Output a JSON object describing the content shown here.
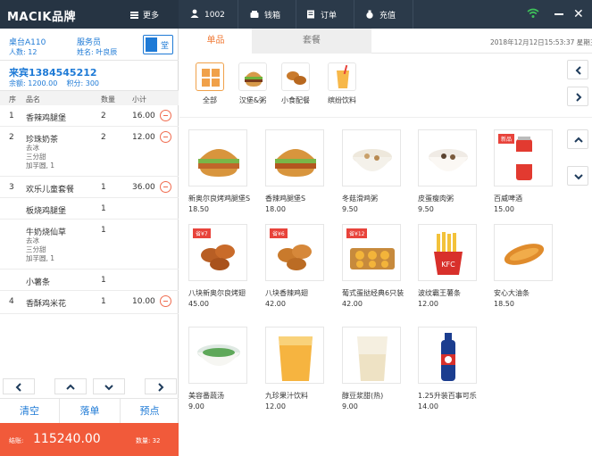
{
  "topbar": {
    "brand": "MACIK品牌",
    "more": "更多",
    "user": "1002",
    "cashbox": "钱箱",
    "orders": "订单",
    "recharge": "充值"
  },
  "left": {
    "table": "桌台A110",
    "people": "人数: 12",
    "waiter_label": "服务员",
    "waiter_name": "姓名: 叶良辰",
    "toggle_label": "堂",
    "member_name": "来宾1384545212",
    "member_balance": "余额: 1200.00",
    "member_points": "积分: 300",
    "headers": {
      "no": "序",
      "name": "品名",
      "qty": "数量",
      "sub": "小计"
    },
    "orders": [
      {
        "no": "1",
        "name": "香辣鸡腿堡",
        "qty": "2",
        "price": "16.00",
        "extras": []
      },
      {
        "no": "2",
        "name": "珍珠奶茶",
        "qty": "2",
        "price": "12.00",
        "extras": [
          "去冰",
          "三分甜",
          "加芋圆, 1"
        ]
      },
      {
        "no": "3",
        "name": "欢乐儿童套餐",
        "qty": "1",
        "price": "36.00",
        "extras": []
      },
      {
        "no": "",
        "name": "板烧鸡腿堡",
        "qty": "1",
        "price": "",
        "extras": []
      },
      {
        "no": "",
        "name": "牛奶烧仙草",
        "qty": "1",
        "price": "",
        "extras": [
          "去冰",
          "三分甜",
          "加芋圆, 1"
        ]
      },
      {
        "no": "",
        "name": "小薯条",
        "qty": "1",
        "price": "",
        "extras": []
      },
      {
        "no": "4",
        "name": "香酥鸡米花",
        "qty": "1",
        "price": "10.00",
        "extras": []
      }
    ],
    "btn_clear": "清空",
    "btn_place": "落单",
    "btn_preorder": "预点",
    "total_label": "结账:",
    "total_value": "115240.00",
    "count_label": "数量: 32"
  },
  "tabs": {
    "single": "单品",
    "combo": "套餐"
  },
  "datetime": "2018年12月12日15:53:37  星期三",
  "categories": [
    {
      "label": "全部"
    },
    {
      "label": "汉堡&粥"
    },
    {
      "label": "小食配餐"
    },
    {
      "label": "缤纷饮料"
    }
  ],
  "products": [
    {
      "name": "新奥尔良烤鸡腿堡S",
      "price": "18.50",
      "tag": ""
    },
    {
      "name": "香辣鸡腿堡S",
      "price": "18.00",
      "tag": ""
    },
    {
      "name": "冬菇滑鸡粥",
      "price": "9.50",
      "tag": ""
    },
    {
      "name": "皮蛋瘦肉粥",
      "price": "9.50",
      "tag": ""
    },
    {
      "name": "百威啤酒",
      "price": "15.00",
      "tag": "新品"
    },
    {
      "name": "八块新奥尔良烤翅",
      "price": "45.00",
      "tag": "省¥7"
    },
    {
      "name": "八块香辣鸡翅",
      "price": "42.00",
      "tag": "省¥6"
    },
    {
      "name": "葡式蛋挞经典6只装",
      "price": "42.00",
      "tag": "省¥12"
    },
    {
      "name": "波纹霸王薯条",
      "price": "12.00",
      "tag": ""
    },
    {
      "name": "安心大油条",
      "price": "18.50",
      "tag": ""
    },
    {
      "name": "美容番蔬汤",
      "price": "9.00",
      "tag": ""
    },
    {
      "name": "九珍果汁饮料",
      "price": "12.00",
      "tag": ""
    },
    {
      "name": "醇豆浆甜(热)",
      "price": "9.00",
      "tag": ""
    },
    {
      "name": "1.25升装百事可乐",
      "price": "14.00",
      "tag": ""
    }
  ],
  "colors": {
    "accent": "#1e7ad6",
    "orange": "#f07c3a",
    "total_bg": "#f15a3a",
    "topbar": "#2b3a4a"
  }
}
